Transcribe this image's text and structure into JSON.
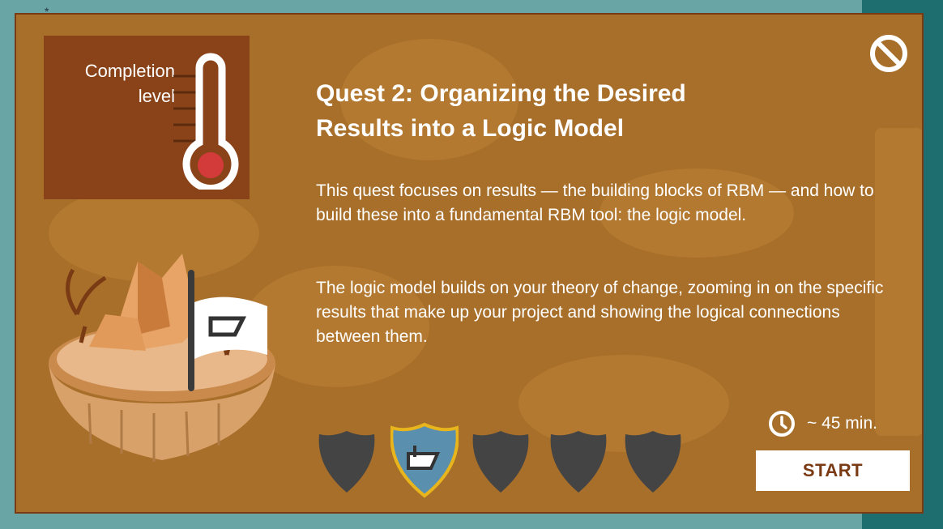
{
  "quest": {
    "completion_label_line1": "Completion",
    "completion_label_line2": "level",
    "title_line1": "Quest 2: Organizing the Desired",
    "title_line2": "Results into a Logic Model",
    "description_1": "This quest focuses on results — the building blocks of RBM — and how to build these into a fundamental RBM tool: the logic model.",
    "description_2": "The logic model builds on your theory of change, zooming in on the specific results that make up your project and showing the logical connections between them.",
    "duration": "~ 45 min.",
    "start_label": "START"
  },
  "badges": [
    {
      "state": "locked",
      "icon": "shield-icon"
    },
    {
      "state": "active",
      "icon": "logic-model-shield-icon"
    },
    {
      "state": "locked",
      "icon": "shield-icon"
    },
    {
      "state": "locked",
      "icon": "shield-icon"
    },
    {
      "state": "locked",
      "icon": "shield-icon"
    }
  ],
  "icons": {
    "close": "no-entry-icon",
    "clock": "clock-icon",
    "thermometer": "thermometer-icon"
  },
  "colors": {
    "modal_bg": "#a86f2a",
    "panel_bg": "#8a4318",
    "thermo_fill": "#d33a3a",
    "badge_locked": "#444444",
    "badge_active_border": "#e8b51c",
    "start_text": "#7a3a14"
  }
}
